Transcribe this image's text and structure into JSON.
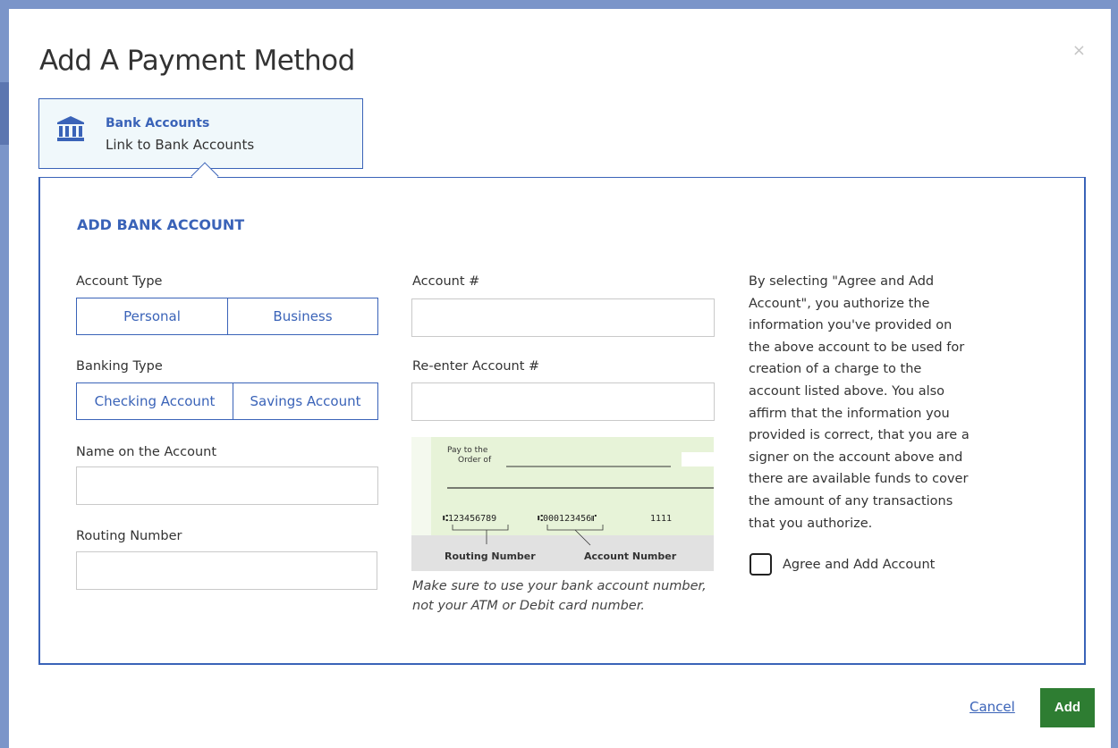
{
  "modal": {
    "title": "Add A Payment Method",
    "close_glyph": "×",
    "tab": {
      "title": "Bank Accounts",
      "subtitle": "Link to Bank Accounts",
      "icon": "bank-icon"
    }
  },
  "form": {
    "section_title": "ADD BANK ACCOUNT",
    "account_type": {
      "label": "Account Type",
      "options": [
        "Personal",
        "Business"
      ]
    },
    "banking_type": {
      "label": "Banking Type",
      "options": [
        "Checking Account",
        "Savings Account"
      ]
    },
    "name_on_account": {
      "label": "Name on the Account",
      "value": ""
    },
    "routing_number": {
      "label": "Routing Number",
      "value": ""
    },
    "account_number": {
      "label": "Account #",
      "value": ""
    },
    "reenter_account_number": {
      "label": "Re-enter Account #",
      "value": ""
    },
    "check_image": {
      "pay_to_line1": "Pay to the",
      "pay_to_line2": "Order of",
      "micr_routing": "⑆123456789",
      "micr_account": "⑆000123456⑈",
      "micr_check": "1111",
      "routing_caption": "Routing Number",
      "account_caption": "Account Number"
    },
    "hint": "Make sure to use your bank account number, not your ATM or Debit card number.",
    "authorization": "By selecting \"Agree and Add Account\", you authorize the information you've provided on the above account to be used for creation of a charge to the account listed above. You also affirm that the information you provided is correct, that you are a signer on the account above and there are available funds to cover the amount of any transactions that you authorize.",
    "agree_label": "Agree and Add Account",
    "agree_checked": false
  },
  "footer": {
    "cancel_label": "Cancel",
    "add_label": "Add"
  },
  "colors": {
    "accent": "#3a63b8",
    "add_button": "#2e7d32",
    "check_background": "#e7f3d8"
  }
}
